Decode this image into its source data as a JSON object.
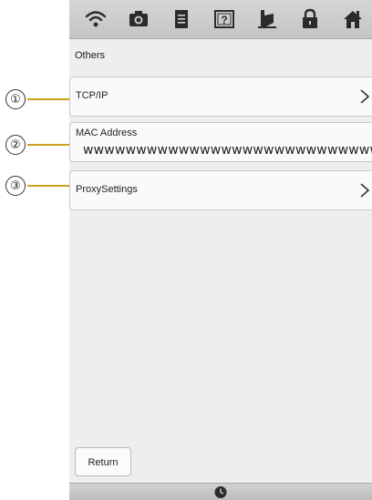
{
  "callouts": [
    "①",
    "②",
    "③"
  ],
  "toolbar": {
    "icons": [
      "wifi-icon",
      "camera-icon",
      "document-icon",
      "help-icon",
      "sewing-foot-icon",
      "lock-icon",
      "home-icon"
    ]
  },
  "section": {
    "title": "Others"
  },
  "rows": {
    "tcpip": {
      "label": "TCP/IP",
      "chevron": ">"
    },
    "mac": {
      "label": "MAC Address",
      "value": "wwwwwwwwwwwwwwwwwwwwwwwwwwwwww"
    },
    "proxy": {
      "label": "ProxySettings",
      "chevron": ">"
    }
  },
  "return_button": {
    "label": "Return"
  },
  "bottom_bar": {
    "icon": "clock-icon"
  },
  "colors": {
    "callout_line": "#c9a318",
    "screen_bg": "#eeeeee",
    "bar_bg": "#c8c8c8",
    "icon": "#2b2b2b"
  }
}
